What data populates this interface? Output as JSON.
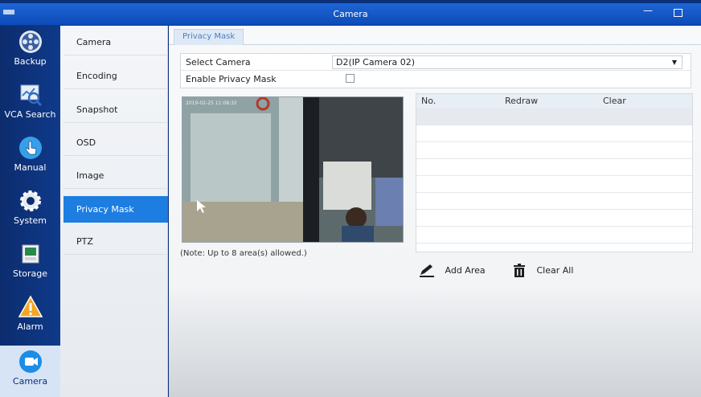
{
  "window": {
    "title": "Camera"
  },
  "nav": [
    {
      "label": "Backup",
      "icon": "film-reel-icon"
    },
    {
      "label": "VCA Search",
      "icon": "vca-search-icon"
    },
    {
      "label": "Manual",
      "icon": "hand-pointer-icon"
    },
    {
      "label": "System",
      "icon": "gear-icon"
    },
    {
      "label": "Storage",
      "icon": "storage-icon"
    },
    {
      "label": "Alarm",
      "icon": "warning-icon"
    },
    {
      "label": "Camera",
      "icon": "camera-icon",
      "active": true
    }
  ],
  "submenu": [
    {
      "label": "Camera"
    },
    {
      "label": "Encoding"
    },
    {
      "label": "Snapshot"
    },
    {
      "label": "OSD"
    },
    {
      "label": "Image"
    },
    {
      "label": "Privacy Mask",
      "active": true
    },
    {
      "label": "PTZ"
    }
  ],
  "tab": {
    "label": "Privacy Mask"
  },
  "form": {
    "select_camera_label": "Select Camera",
    "select_camera_value": "D2(IP Camera 02)",
    "enable_label": "Enable Privacy Mask",
    "enable_checked": false
  },
  "preview": {
    "timestamp": "2019-02-25 11:08:32"
  },
  "note": "(Note: Up to 8 area(s) allowed.)",
  "table": {
    "headers": [
      "No.",
      "Redraw",
      "Clear"
    ]
  },
  "actions": {
    "add_area": "Add Area",
    "clear_all": "Clear All"
  },
  "colors": {
    "accent": "#1d7de0",
    "titlebar": "#1e66d6",
    "sidebar": "#0c2c6e"
  }
}
